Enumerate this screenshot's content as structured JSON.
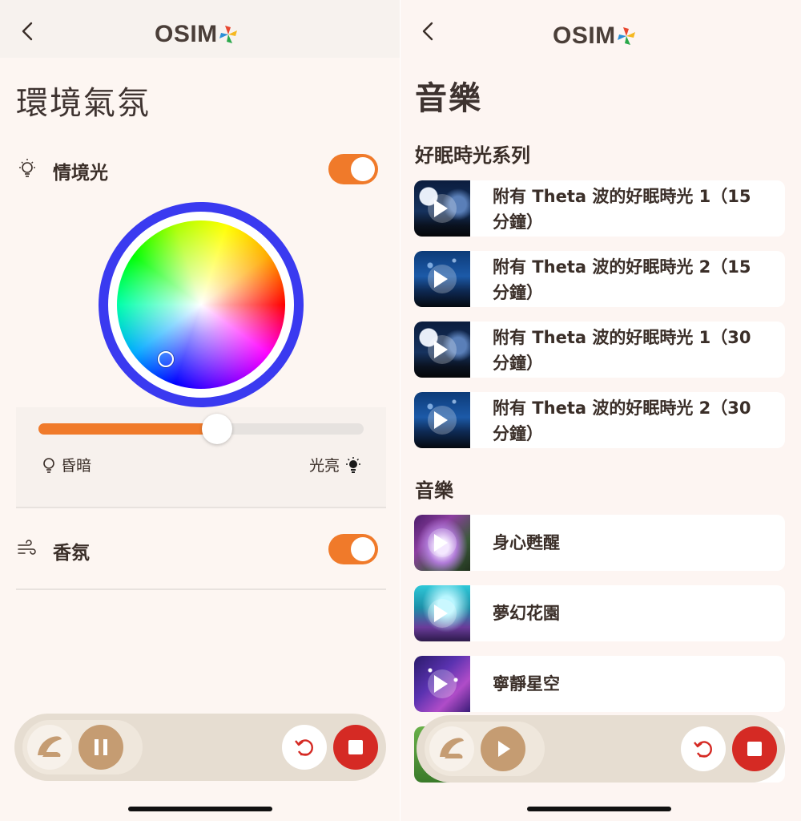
{
  "left": {
    "header": {
      "logo_text": "OSIM"
    },
    "title": "環境氣氛",
    "ambient_light": {
      "label": "情境光",
      "enabled": true,
      "brightness": 0.55
    },
    "brightness": {
      "dim_label": "昏暗",
      "bright_label": "光亮"
    },
    "scent": {
      "label": "香氛",
      "enabled": true
    },
    "player": {
      "state": "playing"
    }
  },
  "right": {
    "header": {
      "logo_text": "OSIM"
    },
    "title": "音樂",
    "sections": [
      {
        "title": "好眠時光系列",
        "tracks": [
          {
            "line1": "附有 Theta 波的好眠時光 1（15",
            "line2": "分鐘）",
            "thumb": "moon-night"
          },
          {
            "line1": "附有 Theta 波的好眠時光 2（15",
            "line2": "分鐘）",
            "thumb": "starry-forest"
          },
          {
            "line1": "附有 Theta 波的好眠時光 1（30",
            "line2": "分鐘）",
            "thumb": "moon-night"
          },
          {
            "line1": "附有 Theta 波的好眠時光 2（30",
            "line2": "分鐘）",
            "thumb": "starry-forest"
          }
        ]
      },
      {
        "title": "音樂",
        "tracks": [
          {
            "line1": "身心甦醒",
            "thumb": "magic-forest"
          },
          {
            "line1": "夢幻花園",
            "thumb": "dream-garden"
          },
          {
            "line1": "寧靜星空",
            "thumb": "starry-sky"
          }
        ]
      }
    ],
    "player": {
      "state": "paused"
    }
  },
  "colors": {
    "accent": "#f07a2a",
    "ring": "#3a3af0",
    "stop": "#d52a24",
    "play": "#c59c72",
    "background": "#fdf6f2"
  },
  "icons": {
    "back": "chevron-left-icon",
    "light": "lightbulb-icon",
    "scent": "wind-icon",
    "reset": "undo-icon",
    "stop": "stop-icon",
    "pause": "pause-icon",
    "play": "play-icon",
    "chair": "massage-chair-icon"
  }
}
